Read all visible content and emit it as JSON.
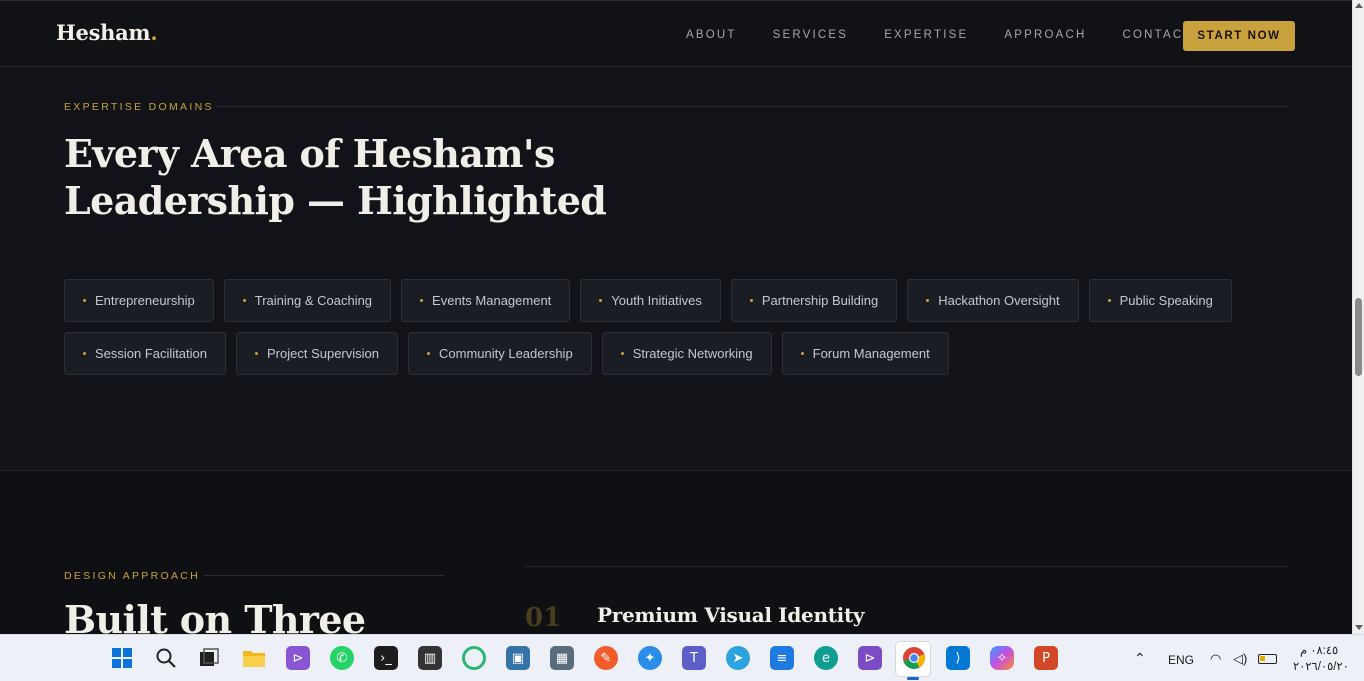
{
  "header": {
    "logo_text": "Hesham",
    "logo_dot": ".",
    "nav": [
      "ABOUT",
      "SERVICES",
      "EXPERTISE",
      "APPROACH",
      "CONTACT"
    ],
    "cta_label": "START NOW"
  },
  "expertise": {
    "eyebrow": "EXPERTISE DOMAINS",
    "title_line1": "Every Area of Hesham's",
    "title_line2": "Leadership — Highlighted",
    "tags_row1": [
      "Entrepreneurship",
      "Training & Coaching",
      "Events Management",
      "Youth Initiatives",
      "Partnership Building",
      "Hackathon Oversight",
      "Public Speaking"
    ],
    "tags_row2": [
      "Session Facilitation",
      "Project Supervision",
      "Community Leadership",
      "Strategic Networking",
      "Forum Management"
    ]
  },
  "approach": {
    "eyebrow": "DESIGN APPROACH",
    "title": "Built on Three",
    "item_number": "01",
    "item_title": "Premium Visual Identity"
  },
  "taskbar": {
    "language": "ENG",
    "time": "٠٨:٤٥ م",
    "date": "٢٠٢٦/٠٥/٢٠",
    "icons": [
      "windows-start-icon",
      "search-icon",
      "task-view-icon",
      "file-explorer-icon",
      "visual-studio-icon",
      "whatsapp-icon",
      "terminal-icon",
      "piano-app-icon",
      "refresh-app-icon",
      "python-app-icon",
      "calculator-icon",
      "app-orange-icon",
      "app-blue-icon",
      "teams-icon",
      "telegram-icon",
      "database-app-icon",
      "edge-icon",
      "visual-studio-purple-icon",
      "chrome-icon",
      "vscode-icon",
      "copilot-icon",
      "powerpoint-icon"
    ]
  },
  "colors": {
    "accent": "#c9a23e",
    "background": "#111318"
  }
}
